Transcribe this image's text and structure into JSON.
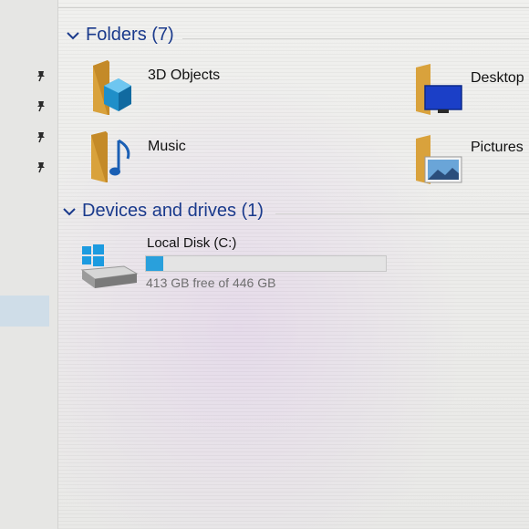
{
  "folders_group": {
    "title": "Folders (7)"
  },
  "folders": [
    {
      "name": "3D Objects",
      "icon": "3d-objects-folder-icon"
    },
    {
      "name": "Desktop",
      "icon": "desktop-folder-icon"
    },
    {
      "name": "Music",
      "icon": "music-folder-icon"
    },
    {
      "name": "Pictures",
      "icon": "pictures-folder-icon"
    }
  ],
  "devices_group": {
    "title": "Devices and drives (1)"
  },
  "drives": [
    {
      "name": "Local Disk (C:)",
      "free_text": "413 GB free of 446 GB",
      "used_fraction": 0.074,
      "icon": "windows-drive-icon"
    }
  ],
  "colors": {
    "accent": "#1a3a8c",
    "drive_bar": "#29a0dc",
    "folder": "#e6b34a"
  }
}
